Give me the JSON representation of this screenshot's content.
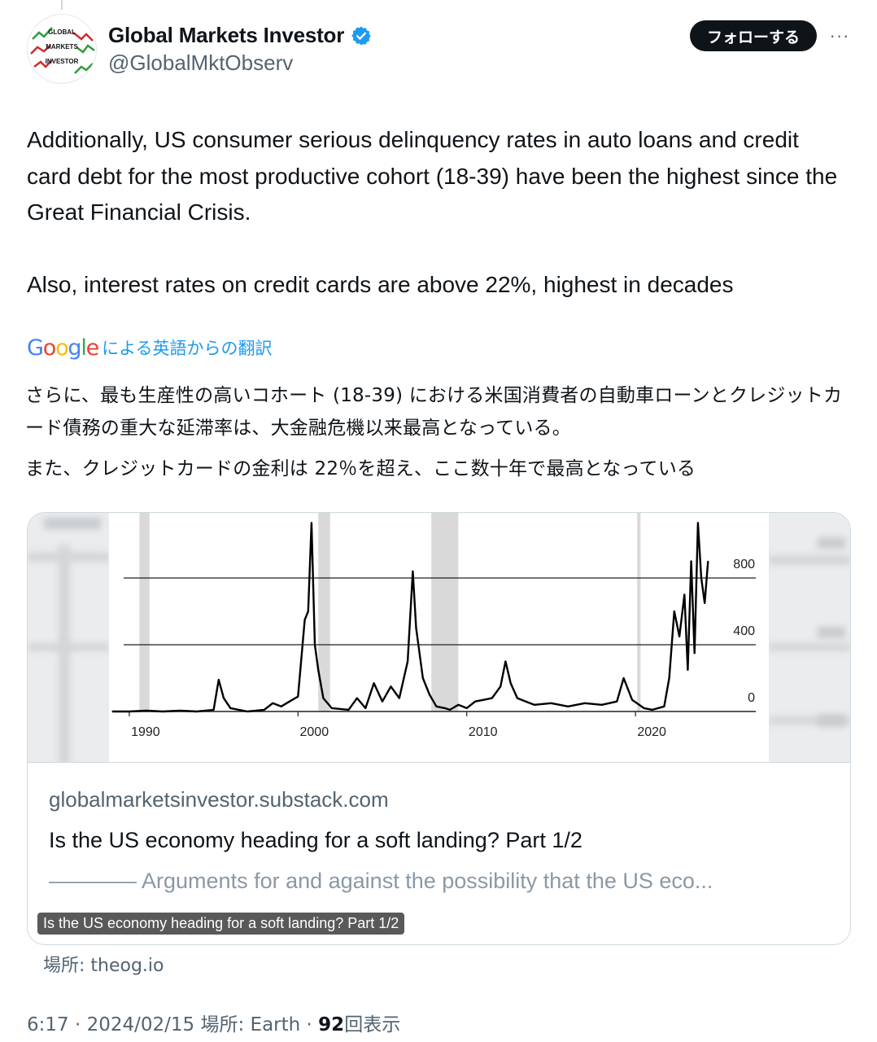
{
  "author": {
    "display_name": "Global Markets Investor",
    "handle": "@GlobalMktObserv",
    "avatar_text": [
      "GLOBAL",
      "MARKETS",
      "INVESTOR"
    ],
    "verified_color": "#1d9bf0"
  },
  "actions": {
    "follow_label": "フォローする",
    "more_label": "···"
  },
  "tweet": {
    "paragraph1": "Additionally, US consumer serious delinquency rates in auto loans and credit card debt for the most productive cohort (18-39) have been the highest since the Great Financial Crisis.",
    "paragraph2": "Also, interest rates on credit cards are above 22%, highest in decades"
  },
  "translation": {
    "logo_text": "Google",
    "label": "による英語からの翻訳",
    "jp_paragraph1": "さらに、最も生産性の高いコホート (18-39) における米国消費者の自動車ローンとクレジットカード債務の重大な延滞率は、大金融危機以来最高となっている。",
    "jp_paragraph2": "また、クレジットカードの金利は 22％を超え、ここ数十年で最高となっている"
  },
  "link_card": {
    "domain": "globalmarketsinvestor.substack.com",
    "title": "Is the US economy heading for a soft landing? Part 1/2",
    "description": "———— Arguments for and against the possibility that the US eco...",
    "overlay_title": "Is the US economy heading for a soft landing? Part 1/2"
  },
  "source": {
    "text": "場所: theog.io"
  },
  "meta": {
    "time": "6:17",
    "date": "2024/02/15",
    "location": "場所: Earth",
    "views_count": "92",
    "views_label": "回表示"
  },
  "chart_data": {
    "type": "line",
    "title": "",
    "xlabel": "",
    "ylabel": "",
    "x_ticks": [
      "1990",
      "2000",
      "2010",
      "2020"
    ],
    "y_ticks": [
      0,
      400,
      800
    ],
    "ylim": [
      -60,
      1170
    ],
    "xlim": [
      1988.8,
      2027.9
    ],
    "grid": true,
    "recession_shading": [
      [
        1990.6,
        1991.2
      ],
      [
        2001.2,
        2001.9
      ],
      [
        2007.9,
        2009.5
      ],
      [
        2020.1,
        2020.3
      ]
    ],
    "series": [
      {
        "name": "",
        "color": "#000000",
        "x": [
          1989.0,
          1990.0,
          1991.0,
          1992.0,
          1993.0,
          1994.0,
          1995.0,
          1995.3,
          1995.6,
          1996.0,
          1997.0,
          1998.0,
          1998.5,
          1999.0,
          1999.5,
          2000.0,
          2000.4,
          2000.6,
          2000.8,
          2001.0,
          2001.2,
          2001.5,
          2002.0,
          2003.0,
          2003.5,
          2004.0,
          2004.5,
          2005.0,
          2005.5,
          2006.0,
          2006.5,
          2006.8,
          2007.0,
          2007.4,
          2007.8,
          2008.2,
          2008.7,
          2009.0,
          2009.5,
          2010.0,
          2010.5,
          2011.0,
          2011.5,
          2012.0,
          2012.3,
          2012.6,
          2013.0,
          2013.5,
          2014.0,
          2015.0,
          2016.0,
          2017.0,
          2018.0,
          2018.9,
          2019.3,
          2019.8,
          2020.5,
          2021.0,
          2021.7,
          2022.0,
          2022.3,
          2022.6,
          2022.9,
          2023.1,
          2023.3,
          2023.5,
          2023.7,
          2023.9,
          2024.1,
          2024.3
        ],
        "values": [
          0,
          0,
          5,
          0,
          5,
          0,
          10,
          190,
          80,
          20,
          0,
          10,
          50,
          30,
          60,
          90,
          550,
          600,
          1130,
          400,
          250,
          80,
          20,
          10,
          80,
          20,
          170,
          60,
          150,
          80,
          300,
          840,
          500,
          200,
          100,
          30,
          20,
          10,
          40,
          20,
          60,
          70,
          80,
          150,
          300,
          170,
          80,
          60,
          40,
          50,
          30,
          50,
          40,
          60,
          200,
          70,
          20,
          10,
          30,
          200,
          600,
          450,
          700,
          250,
          900,
          350,
          1130,
          800,
          650,
          900
        ]
      }
    ]
  }
}
